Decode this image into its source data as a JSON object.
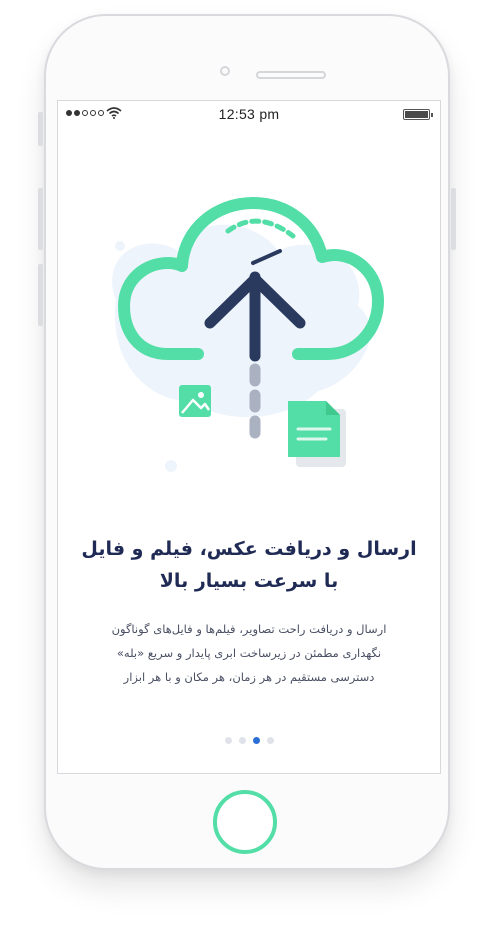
{
  "status_bar": {
    "time": "12:53 pm"
  },
  "onboarding": {
    "title_line1": "ارسال و دریافت عکس، فیلم و فایل",
    "title_line2": "با سرعت بسیار بالا",
    "desc_line1": "ارسال و دریافت راحت تصاویر، فیلم‌ها و فایل‌های گوناگون",
    "desc_line2": "نگهداری مطمئن در زیرساخت ابری پایدار و سریع «بله»",
    "desc_line3": "دسترسی مستقیم در هر زمان، هر مکان و با هر ابزار"
  },
  "pagination": {
    "total": 4,
    "active_index": 2
  },
  "colors": {
    "accent_green": "#52dea6",
    "navy": "#2a3a5e",
    "active_dot": "#2a6fd6"
  }
}
